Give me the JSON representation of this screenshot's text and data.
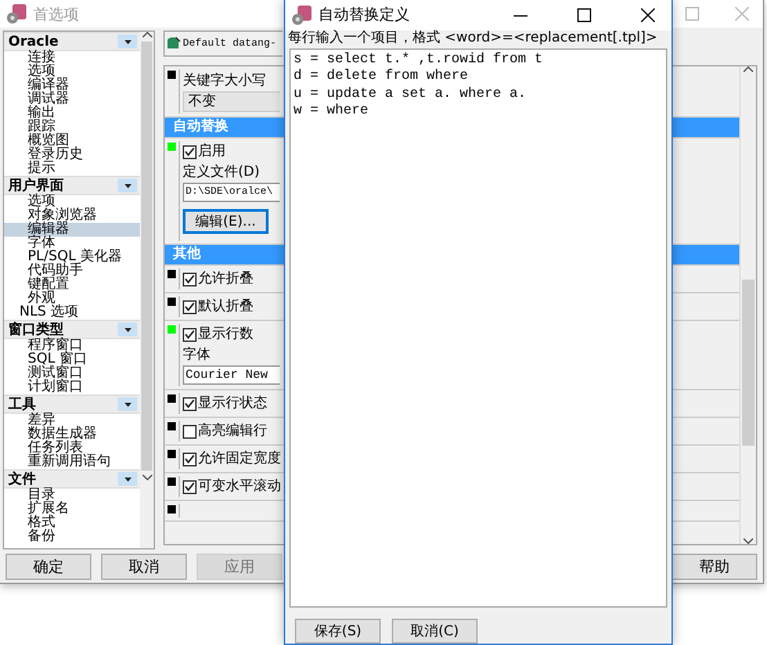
{
  "preferences_window": {
    "title": "首选项",
    "active": false,
    "sidebar": {
      "groups": [
        {
          "label": "Oracle",
          "items": [
            {
              "label": "连接",
              "selected": false
            },
            {
              "label": "选项",
              "selected": false
            },
            {
              "label": "编译器",
              "selected": false
            },
            {
              "label": "调试器",
              "selected": false
            },
            {
              "label": "输出",
              "selected": false
            },
            {
              "label": "跟踪",
              "selected": false
            },
            {
              "label": "概览图",
              "selected": false
            },
            {
              "label": "登录历史",
              "selected": false
            },
            {
              "label": "提示",
              "selected": false
            }
          ]
        },
        {
          "label": "用户界面",
          "items": [
            {
              "label": "选项",
              "selected": false
            },
            {
              "label": "对象浏览器",
              "selected": false
            },
            {
              "label": "编辑器",
              "selected": true
            },
            {
              "label": "字体",
              "selected": false
            },
            {
              "label": "PL/SQL 美化器",
              "selected": false
            },
            {
              "label": "代码助手",
              "selected": false
            },
            {
              "label": "键配置",
              "selected": false
            },
            {
              "label": "外观",
              "selected": false
            }
          ],
          "trailing_item": {
            "label": "NLS 选项",
            "selected": false
          }
        },
        {
          "label": "窗口类型",
          "items": [
            {
              "label": "程序窗口",
              "selected": false
            },
            {
              "label": "SQL 窗口",
              "selected": false
            },
            {
              "label": "测试窗口",
              "selected": false
            },
            {
              "label": "计划窗口",
              "selected": false
            }
          ]
        },
        {
          "label": "工具",
          "items": [
            {
              "label": "差异",
              "selected": false
            },
            {
              "label": "数据生成器",
              "selected": false
            },
            {
              "label": "任务列表",
              "selected": false
            },
            {
              "label": "重新调用语句",
              "selected": false
            }
          ]
        },
        {
          "label": "文件",
          "items": [
            {
              "label": "目录",
              "selected": false
            },
            {
              "label": "扩展名",
              "selected": false
            },
            {
              "label": "格式",
              "selected": false
            },
            {
              "label": "备份",
              "selected": false
            }
          ]
        }
      ]
    },
    "profile_selector": {
      "value": "Default datang-"
    },
    "settings": [
      {
        "kind": "dropdown",
        "color": "#000000",
        "label": "关键字大小写",
        "value": "不变"
      },
      {
        "kind": "header",
        "title": "自动替换"
      },
      {
        "kind": "file",
        "color": "#00ff00",
        "label": "启用",
        "checked": true,
        "file_label": "定义文件(D)",
        "file_path": "D:\\SDE\\oralce\\",
        "button": "编辑(E)..."
      },
      {
        "kind": "header",
        "title": "其他"
      },
      {
        "kind": "check",
        "color": "#000000",
        "label": "允许折叠",
        "checked": true
      },
      {
        "kind": "check",
        "color": "#000000",
        "label": "默认折叠",
        "checked": true
      },
      {
        "kind": "font",
        "color": "#00ff00",
        "label": "显示行数",
        "checked": true,
        "font_label": "字体",
        "font_value": "Courier New"
      },
      {
        "kind": "check",
        "color": "#000000",
        "label": "显示行状态",
        "checked": true
      },
      {
        "kind": "check",
        "color": "#000000",
        "label": "高亮编辑行",
        "checked": false
      },
      {
        "kind": "check",
        "color": "#000000",
        "label": "允许固定宽度",
        "checked": true
      },
      {
        "kind": "check",
        "color": "#000000",
        "label": "可变水平滚动",
        "checked": true
      },
      {
        "kind": "stub",
        "color": "#000000"
      }
    ],
    "buttons": [
      {
        "label": "确定",
        "disabled": false
      },
      {
        "label": "取消",
        "disabled": false
      },
      {
        "label": "应用",
        "disabled": true
      },
      {
        "label": "帮助",
        "disabled": false
      }
    ]
  },
  "replace_dialog": {
    "title": "自动替换定义",
    "hint": "每行输入一个项目，格式 <word>=<replacement[.tpl]>",
    "lines": [
      "s = select t.* ,t.rowid from t",
      "d = delete from where",
      "u = update a set a. where a.",
      "w = where"
    ],
    "buttons": [
      "保存(S)",
      "取消(C)"
    ]
  }
}
